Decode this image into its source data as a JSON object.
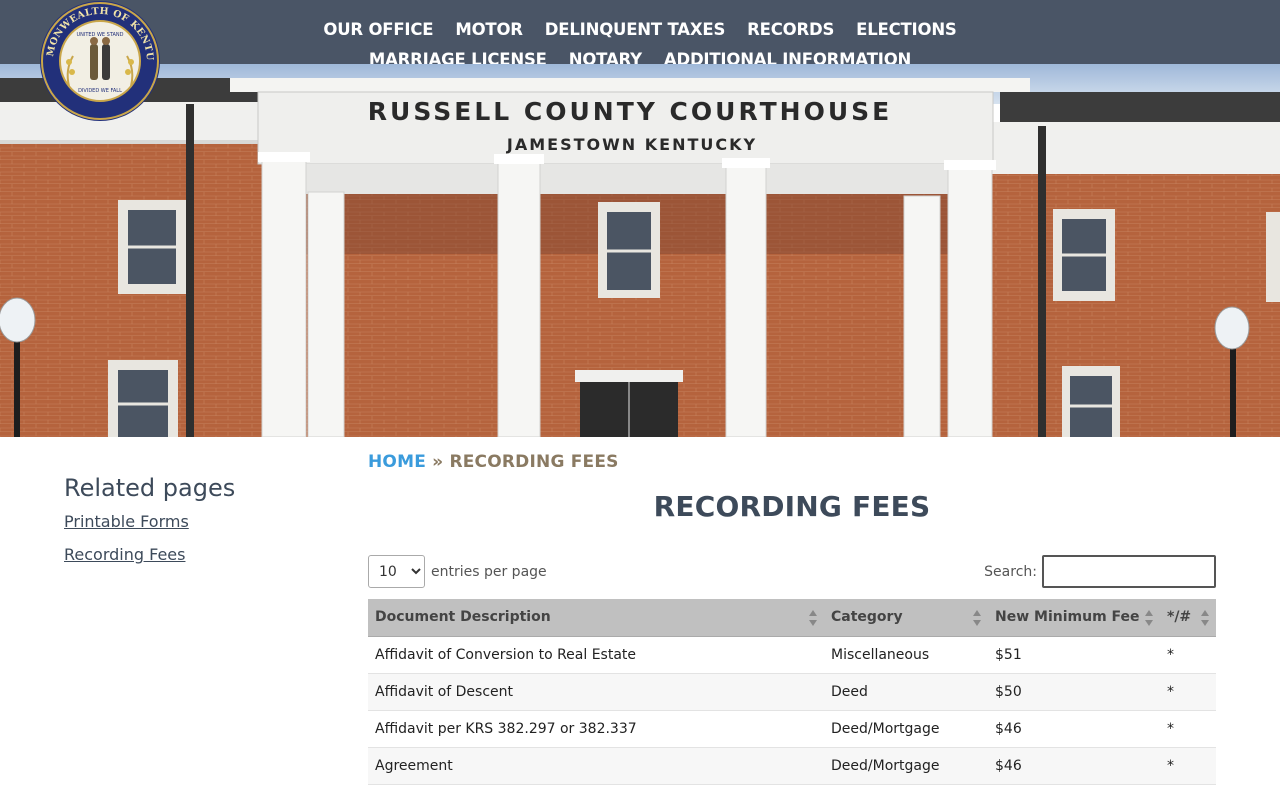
{
  "nav": {
    "items": [
      "OUR OFFICE",
      "MOTOR",
      "DELINQUENT TAXES",
      "RECORDS",
      "ELECTIONS",
      "MARRIAGE LICENSE",
      "NOTARY",
      "ADDITIONAL INFORMATION"
    ]
  },
  "seal": {
    "top_text": "COMMONWEALTH OF KENTUCKY",
    "inner_top": "UNITED WE STAND",
    "inner_bottom": "DIVIDED WE FALL"
  },
  "hero": {
    "sign_line1": "RUSSELL COUNTY COURTHOUSE",
    "sign_line2": "JAMESTOWN KENTUCKY"
  },
  "sidebar": {
    "heading": "Related pages",
    "links": [
      "Printable Forms",
      "Recording Fees"
    ]
  },
  "breadcrumb": {
    "home": "HOME",
    "separator": "»",
    "current": "RECORDING FEES"
  },
  "page": {
    "title": "RECORDING FEES"
  },
  "table_controls": {
    "entries_value": "10",
    "entries_label": "entries per page",
    "search_label": "Search:",
    "search_value": ""
  },
  "table": {
    "columns": [
      "Document Description",
      "Category",
      "New Minimum Fee",
      "*/#"
    ],
    "rows": [
      [
        "Affidavit of Conversion to Real Estate",
        "Miscellaneous",
        "$51",
        "*"
      ],
      [
        "Affidavit of Descent",
        "Deed",
        "$50",
        "*"
      ],
      [
        "Affidavit per KRS 382.297 or 382.337",
        "Deed/Mortgage",
        "$46",
        "*"
      ],
      [
        "Agreement",
        "Deed/Mortgage",
        "$46",
        "*"
      ]
    ]
  },
  "colors": {
    "header_bg": "#4a5566",
    "link_blue": "#3a9bdc",
    "crumb_brown": "#8a7a62",
    "table_header_bg": "#c0c0c0"
  }
}
